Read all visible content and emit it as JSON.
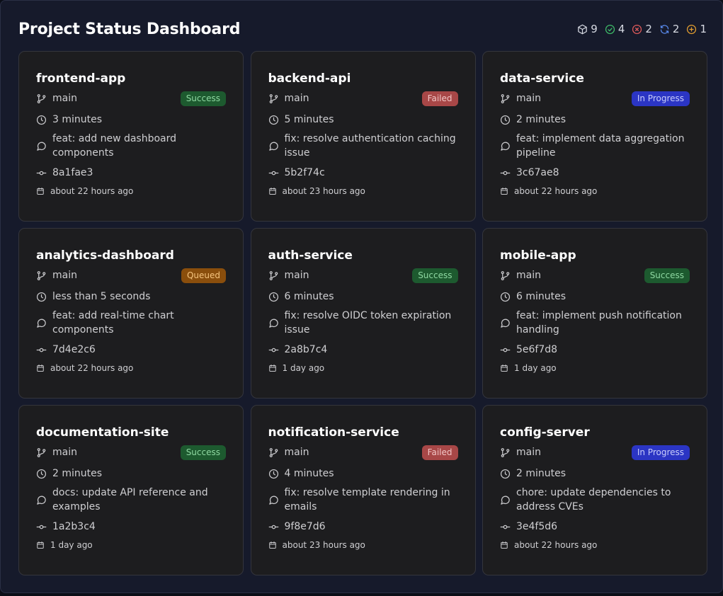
{
  "header": {
    "title": "Project Status Dashboard",
    "stats": [
      {
        "icon": "box-icon",
        "value": "9",
        "color": "#d7dae3"
      },
      {
        "icon": "check-circle-icon",
        "value": "4",
        "color": "#3fbf6a"
      },
      {
        "icon": "x-circle-icon",
        "value": "2",
        "color": "#e35b5b"
      },
      {
        "icon": "refresh-icon",
        "value": "2",
        "color": "#5a8cf0"
      },
      {
        "icon": "plus-circle-icon",
        "value": "1",
        "color": "#e6a030"
      }
    ]
  },
  "projects": [
    {
      "name": "frontend-app",
      "branch": "main",
      "status": "Success",
      "status_key": "success",
      "duration": "3 minutes",
      "message": "feat: add new dashboard components",
      "commit": "8a1fae3",
      "time": "about 22 hours ago"
    },
    {
      "name": "backend-api",
      "branch": "main",
      "status": "Failed",
      "status_key": "failed",
      "duration": "5 minutes",
      "message": "fix: resolve authentication caching issue",
      "commit": "5b2f74c",
      "time": "about 23 hours ago"
    },
    {
      "name": "data-service",
      "branch": "main",
      "status": "In Progress",
      "status_key": "inprogress",
      "duration": "2 minutes",
      "message": "feat: implement data aggregation pipeline",
      "commit": "3c67ae8",
      "time": "about 22 hours ago"
    },
    {
      "name": "analytics-dashboard",
      "branch": "main",
      "status": "Queued",
      "status_key": "queued",
      "duration": "less than 5 seconds",
      "message": "feat: add real-time chart components",
      "commit": "7d4e2c6",
      "time": "about 22 hours ago"
    },
    {
      "name": "auth-service",
      "branch": "main",
      "status": "Success",
      "status_key": "success",
      "duration": "6 minutes",
      "message": "fix: resolve OIDC token expiration issue",
      "commit": "2a8b7c4",
      "time": "1 day ago"
    },
    {
      "name": "mobile-app",
      "branch": "main",
      "status": "Success",
      "status_key": "success",
      "duration": "6 minutes",
      "message": "feat: implement push notification handling",
      "commit": "5e6f7d8",
      "time": "1 day ago"
    },
    {
      "name": "documentation-site",
      "branch": "main",
      "status": "Success",
      "status_key": "success",
      "duration": "2 minutes",
      "message": "docs: update API reference and examples",
      "commit": "1a2b3c4",
      "time": "1 day ago"
    },
    {
      "name": "notification-service",
      "branch": "main",
      "status": "Failed",
      "status_key": "failed",
      "duration": "4 minutes",
      "message": "fix: resolve template rendering in emails",
      "commit": "9f8e7d6",
      "time": "about 23 hours ago"
    },
    {
      "name": "config-server",
      "branch": "main",
      "status": "In Progress",
      "status_key": "inprogress",
      "duration": "2 minutes",
      "message": "chore: update dependencies to address CVEs",
      "commit": "3e4f5d6",
      "time": "about 22 hours ago"
    }
  ]
}
